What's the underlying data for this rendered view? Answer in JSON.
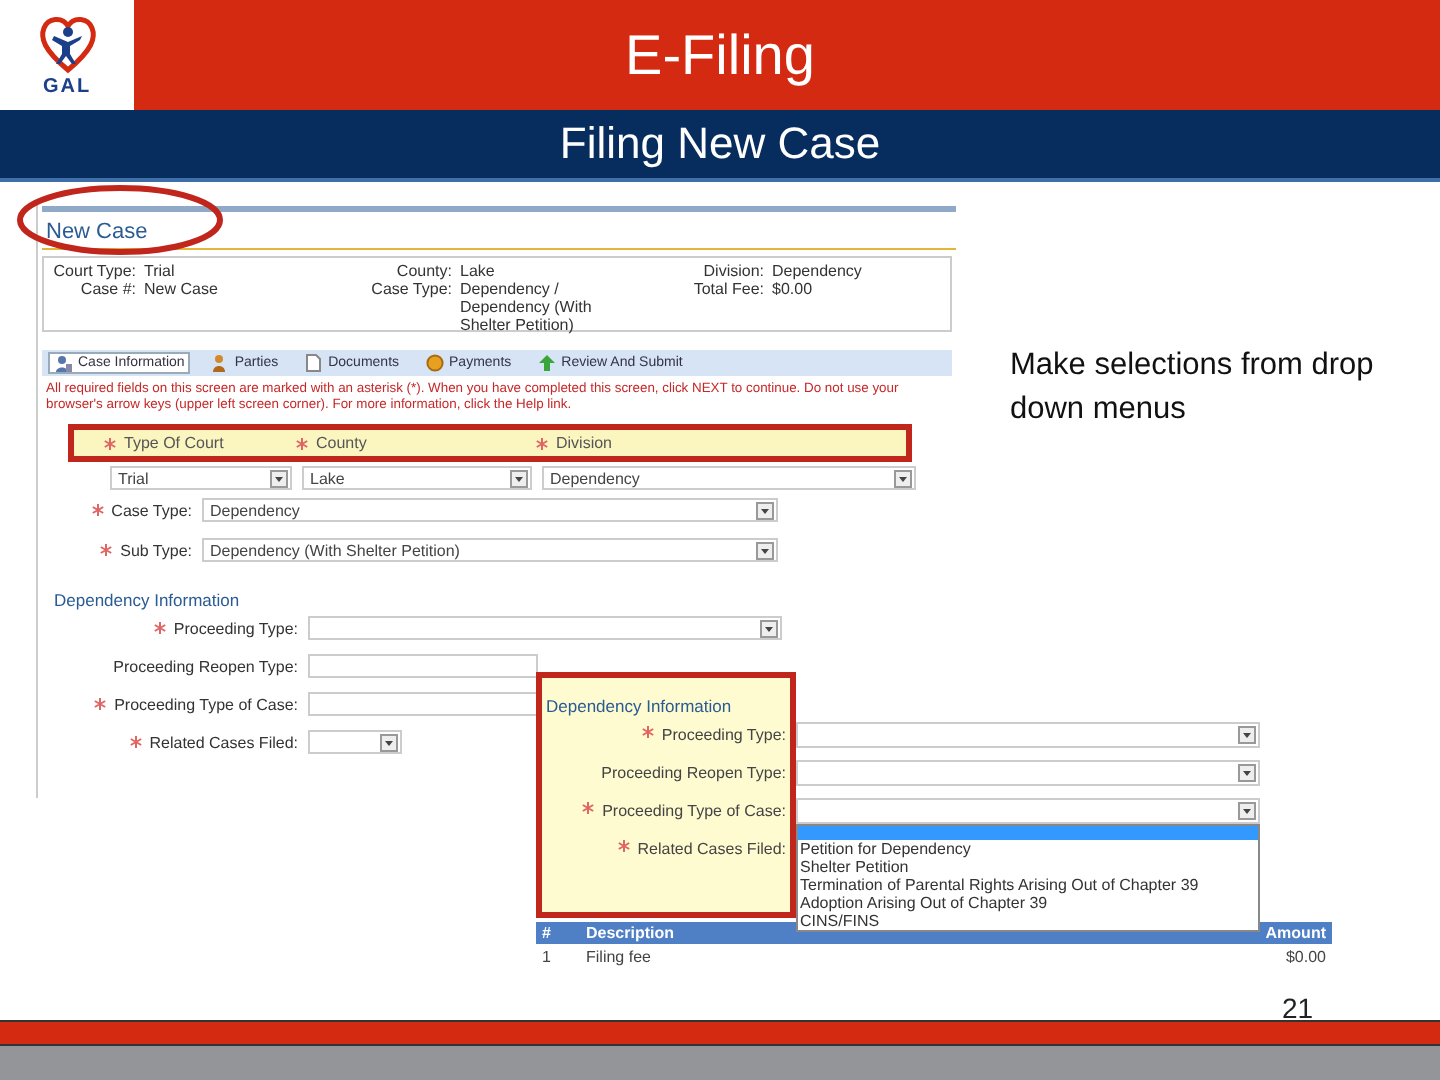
{
  "header": {
    "logo_text": "GAL",
    "title": "E-Filing"
  },
  "subheader": {
    "title": "Filing New Case"
  },
  "screenshot": {
    "title": "New Case",
    "summary": [
      {
        "label": "Court Type:",
        "value": "Trial"
      },
      {
        "label": "County:",
        "value": "Lake"
      },
      {
        "label": "Division:",
        "value": "Dependency"
      },
      {
        "label": "Case #:",
        "value": "New Case"
      },
      {
        "label": "Case Type:",
        "value": "Dependency / Dependency (With Shelter Petition)"
      },
      {
        "label": "Total Fee:",
        "value": "$0.00"
      }
    ],
    "tabs": [
      {
        "label": "Case Information",
        "selected": true
      },
      {
        "label": "Parties",
        "selected": false
      },
      {
        "label": "Documents",
        "selected": false
      },
      {
        "label": "Payments",
        "selected": false
      },
      {
        "label": "Review And Submit",
        "selected": false
      }
    ],
    "notice": "All required fields on this screen are marked with an asterisk (*). When you have completed this screen, click NEXT to continue. Do not use your browser's arrow keys (upper left screen corner). For more information, click the Help link.",
    "court_fields": [
      {
        "label": "Type Of Court",
        "required": true,
        "value": "Trial"
      },
      {
        "label": "County",
        "required": true,
        "value": "Lake"
      },
      {
        "label": "Division",
        "required": true,
        "value": "Dependency"
      }
    ],
    "case_fields": [
      {
        "label": "Case Type:",
        "required": true,
        "value": "Dependency"
      },
      {
        "label": "Sub Type:",
        "required": true,
        "value": "Dependency (With Shelter Petition)"
      }
    ],
    "section_title": "Dependency Information",
    "dependency_fields": [
      {
        "label": "Proceeding Type:",
        "required": true,
        "kind": "dropdown"
      },
      {
        "label": "Proceeding Reopen Type:",
        "required": false,
        "kind": "covered"
      },
      {
        "label": "Proceeding Type of Case:",
        "required": true,
        "kind": "covered"
      },
      {
        "label": "Related Cases Filed:",
        "required": true,
        "kind": "short-dropdown"
      }
    ]
  },
  "callout": {
    "section_title": "Dependency Information",
    "fields": [
      {
        "label": "Proceeding Type:",
        "required": true
      },
      {
        "label": "Proceeding Reopen Type:",
        "required": false
      },
      {
        "label": "Proceeding Type of Case:",
        "required": true
      },
      {
        "label": "Related Cases Filed:",
        "required": true
      }
    ],
    "blank_option_selected": true,
    "dropdown_options": [
      {
        "label": "Petition for Dependency",
        "selected": false
      },
      {
        "label": "Shelter Petition",
        "selected": false
      },
      {
        "label": "Termination of Parental Rights Arising Out of Chapter 39",
        "selected": false
      },
      {
        "label": "Adoption Arising Out of Chapter 39",
        "selected": false
      },
      {
        "label": "CINS/FINS",
        "selected": false
      }
    ],
    "fee_table": {
      "columns": [
        "#",
        "Description",
        "Amount"
      ],
      "rows": [
        [
          "1",
          "Filing fee",
          "$0.00"
        ]
      ]
    }
  },
  "note": "Make selections from drop down menus",
  "page_number": "21"
}
